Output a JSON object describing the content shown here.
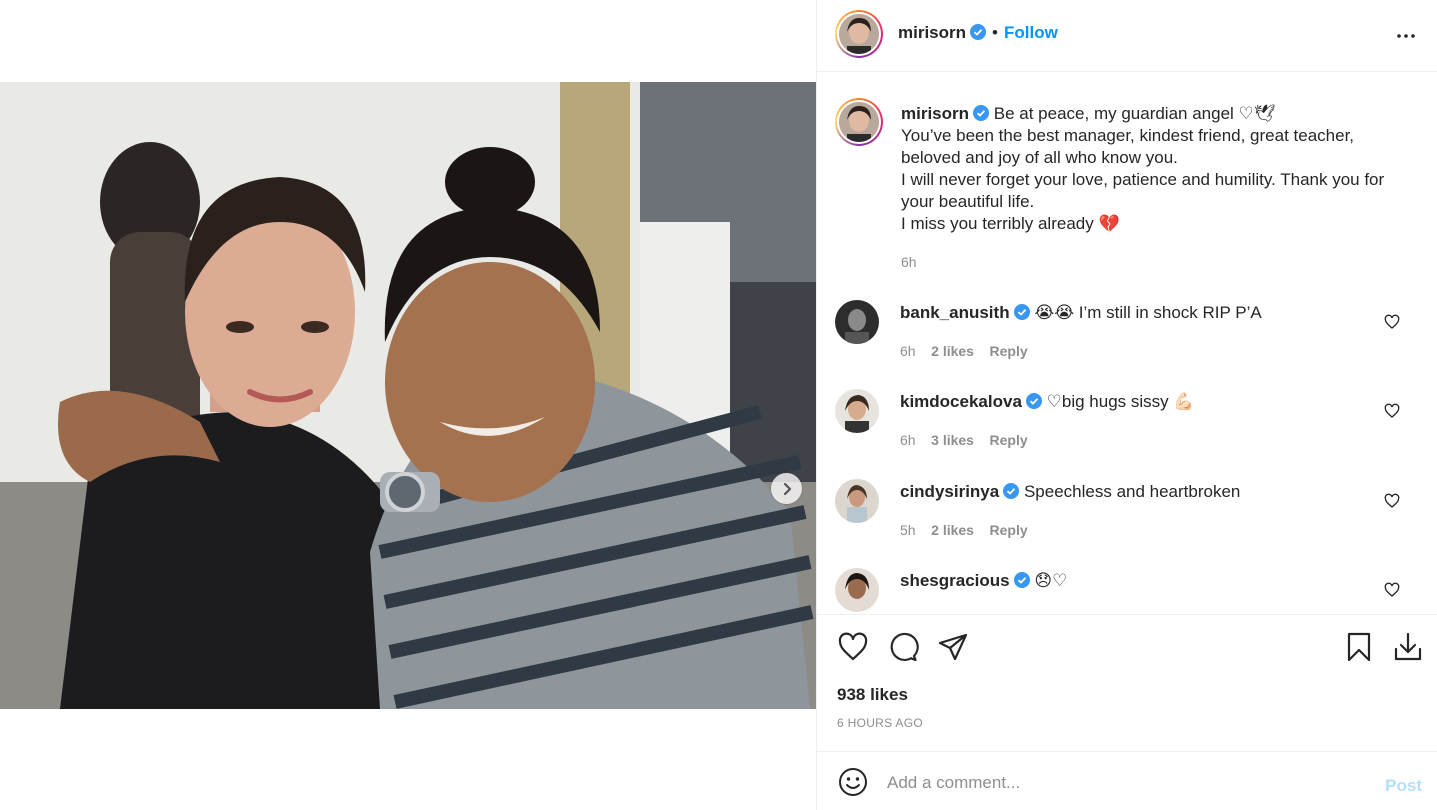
{
  "post": {
    "author": "mirisorn",
    "follow_label": "Follow",
    "separator": "•",
    "caption_lines": [
      "Be at peace, my guardian angel ♡🕊",
      "You’ve been the best manager, kindest friend, great teacher,",
      "beloved and joy of all who know you.",
      "I will never forget your love, patience and humility. Thank you for",
      "your beautiful life.",
      "I miss you terribly already 💔"
    ],
    "caption_time": "6h",
    "likes": "938 likes",
    "time_ago": "6 HOURS AGO"
  },
  "comments": [
    {
      "user": "bank_anusith",
      "text": "😭😭 I’m still in shock RIP P’A",
      "time": "6h",
      "likes": "2 likes",
      "reply": "Reply"
    },
    {
      "user": "kimdocekalova",
      "text": "♡big hugs sissy 💪🏻",
      "time": "6h",
      "likes": "3 likes",
      "reply": "Reply"
    },
    {
      "user": "cindysirinya",
      "text": "Speechless and heartbroken",
      "time": "5h",
      "likes": "2 likes",
      "reply": "Reply"
    },
    {
      "user": "shesgracious",
      "text": "😞♡",
      "time": "",
      "likes": "",
      "reply": ""
    }
  ],
  "composer": {
    "placeholder": "Add a comment...",
    "post_label": "Post"
  },
  "colors": {
    "link_blue": "#0095f6",
    "post_disabled": "#b2dffc",
    "verified_blue": "#3897f0",
    "muted_text": "#8e8e8e"
  },
  "icons": {
    "more": "more-horizontal-icon",
    "like": "heart-icon",
    "comment": "comment-icon",
    "share": "share-icon",
    "save": "bookmark-icon",
    "download": "download-icon",
    "emoji": "emoji-icon",
    "next": "chevron-right-icon"
  }
}
